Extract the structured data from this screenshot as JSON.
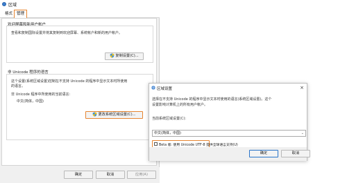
{
  "window": {
    "title": "区域"
  },
  "tabs": [
    {
      "label": "格式"
    },
    {
      "label": "管理"
    }
  ],
  "welcome_section": {
    "title": "欢迎屏幕和新用户帐户",
    "description": "查看和复制国际设置并将其复制到欢迎屏幕、系统帐户和新的用户帐户。",
    "copy_button": "复制设置(C)..."
  },
  "unicode_section": {
    "title": "非 Unicode 程序的语言",
    "description_line1": "这个设置(系统区域设置)控制在不支持 Unicode 的程序中显示文本时所使用",
    "description_line2": "的语言。",
    "current_label": "非 Unicode 程序中所使用的当前语言:",
    "current_value": "中文(简体，中国)",
    "change_button": "更改系统区域设置(C)..."
  },
  "bottom_buttons": {
    "ok": "确定",
    "cancel": "取消",
    "apply": "应用(A)"
  },
  "dialog": {
    "title": "区域设置",
    "close": "×",
    "description_line1": "选择在不支持 Unicode 的程序中显示文本时使用的语言(系统区域设置)。这个",
    "description_line2": "设置影响计算机上的所有用户帐户。",
    "select_label": "当前系统区域设置(C):",
    "select_value": "中文(简体，中国)",
    "beta_label": "Beta 版: 使用 Unicode UTF-8 提供全球语言支持(U)",
    "beta_checked": false,
    "ok": "确定",
    "cancel": "取消"
  },
  "colors": {
    "highlight": "#e6842f",
    "primary_border": "#2a74c9"
  }
}
